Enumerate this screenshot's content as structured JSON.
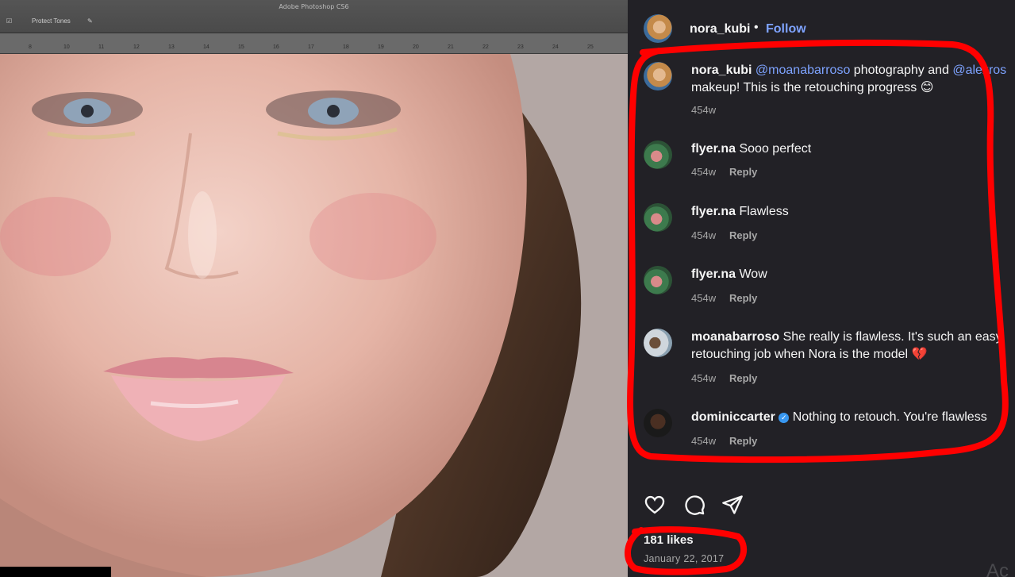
{
  "photo": {
    "app_title": "Adobe Photoshop CS6",
    "toolbar_label": "Protect Tones",
    "ruler_ticks": [
      "8",
      "10",
      "11",
      "12",
      "13",
      "14",
      "15",
      "16",
      "17",
      "18",
      "19",
      "20",
      "21",
      "22",
      "23",
      "24",
      "25"
    ]
  },
  "post": {
    "author": "nora_kubi",
    "dot": "•",
    "follow_label": "Follow",
    "caption": {
      "user": "nora_kubi",
      "mention1": "@moanabarroso",
      "text1": " photography and ",
      "mention2": "@alexros",
      "line2": "makeup! This is the retouching progress 😊",
      "time": "454w"
    },
    "comments": [
      {
        "user": "flyer.na",
        "text": " Sooo perfect",
        "time": "454w",
        "reply": "Reply"
      },
      {
        "user": "flyer.na",
        "text": " Flawless",
        "time": "454w",
        "reply": "Reply"
      },
      {
        "user": "flyer.na",
        "text": " Wow",
        "time": "454w",
        "reply": "Reply"
      },
      {
        "user": "moanabarroso",
        "text": " She really is flawless. It's such an easy",
        "line2": "retouching job when Nora is the model 💔",
        "time": "454w",
        "reply": "Reply"
      },
      {
        "user": "dominiccarter",
        "verified_glyph": "✓",
        "text": " Nothing to retouch. You're flawless",
        "time": "454w",
        "reply": "Reply"
      }
    ],
    "likes": "181 likes",
    "date": "January 22, 2017",
    "ghost": "Ac"
  },
  "colors": {
    "panel_bg": "#222126",
    "link_blue": "#7ea3ff",
    "annotation_red": "#ff0000",
    "meta_gray": "#a8a8a8"
  },
  "icons": [
    "heart-icon",
    "comment-icon",
    "share-icon",
    "verified-badge-icon"
  ]
}
